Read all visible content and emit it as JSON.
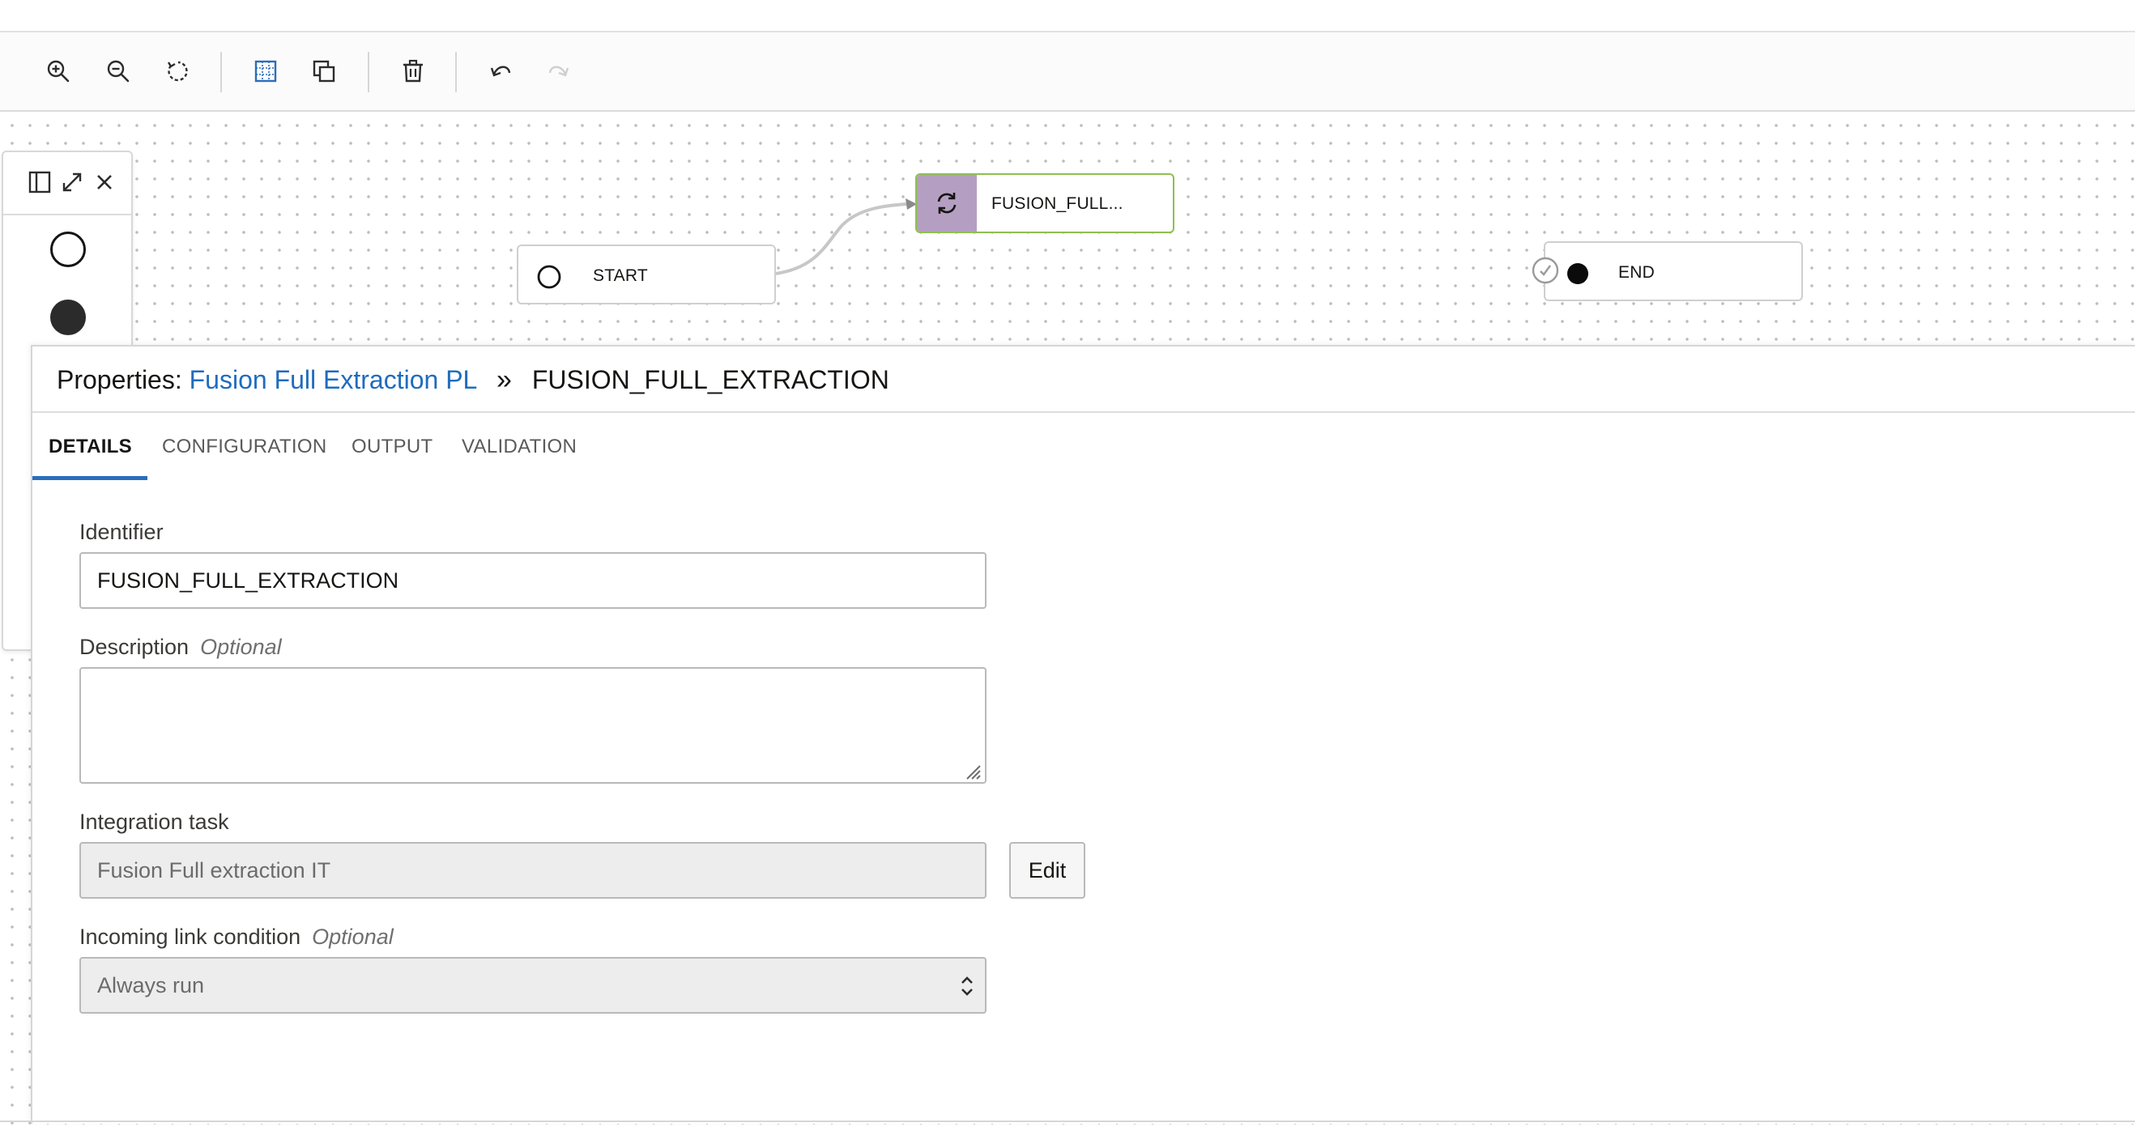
{
  "toolbar": {
    "zoom_in": "zoom-in",
    "zoom_out": "zoom-out",
    "reset": "reset-zoom",
    "grid": "grid",
    "copy": "copy",
    "delete": "delete",
    "undo": "undo",
    "redo": "redo"
  },
  "canvas": {
    "nodes": {
      "start": "START",
      "task": "FUSION_FULL...",
      "end": "END"
    }
  },
  "properties": {
    "prefix": "Properties:",
    "pipeline_link": "Fusion Full Extraction PL",
    "separator": "»",
    "task_name": "FUSION_FULL_EXTRACTION",
    "tabs": [
      "DETAILS",
      "CONFIGURATION",
      "OUTPUT",
      "VALIDATION"
    ],
    "active_tab": "DETAILS",
    "identifier_label": "Identifier",
    "identifier_value": "FUSION_FULL_EXTRACTION",
    "description_label": "Description",
    "description_optional": "Optional",
    "description_value": "",
    "integration_label": "Integration task",
    "integration_value": "Fusion Full extraction IT",
    "edit_button": "Edit",
    "condition_label": "Incoming link condition",
    "condition_optional": "Optional",
    "condition_value": "Always run"
  },
  "colors": {
    "accent": "#2a6ebb",
    "link": "#1f6cbf",
    "task_icon_bg": "#b49fc2",
    "task_border": "#8fbf4f"
  }
}
